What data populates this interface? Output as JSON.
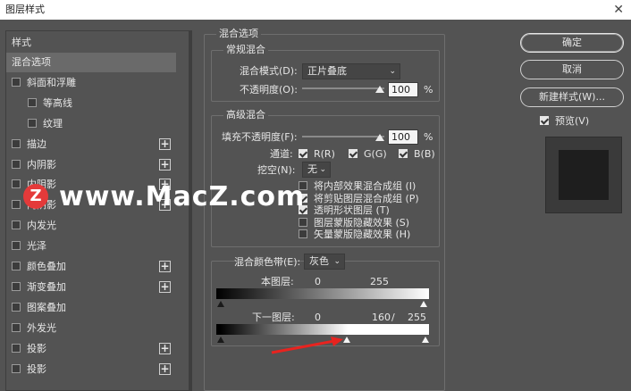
{
  "window": {
    "title": "图层样式",
    "close": "✕"
  },
  "styles": {
    "header": "样式",
    "items": [
      {
        "label": "混合选项",
        "checkbox": false,
        "plus": false,
        "selected": true
      },
      {
        "label": "斜面和浮雕",
        "checkbox": true,
        "plus": false
      },
      {
        "label": "等高线",
        "checkbox": true,
        "plus": false,
        "indent": true
      },
      {
        "label": "纹理",
        "checkbox": true,
        "plus": false,
        "indent": true
      },
      {
        "label": "描边",
        "checkbox": true,
        "plus": true
      },
      {
        "label": "内阴影",
        "checkbox": true,
        "plus": true
      },
      {
        "label": "内阴影",
        "checkbox": true,
        "plus": true
      },
      {
        "label": "内阴影",
        "checkbox": true,
        "plus": true
      },
      {
        "label": "内发光",
        "checkbox": true,
        "plus": false
      },
      {
        "label": "光泽",
        "checkbox": true,
        "plus": false
      },
      {
        "label": "颜色叠加",
        "checkbox": true,
        "plus": true
      },
      {
        "label": "渐变叠加",
        "checkbox": true,
        "plus": true
      },
      {
        "label": "图案叠加",
        "checkbox": true,
        "plus": false
      },
      {
        "label": "外发光",
        "checkbox": true,
        "plus": false
      },
      {
        "label": "投影",
        "checkbox": true,
        "plus": true
      },
      {
        "label": "投影",
        "checkbox": true,
        "plus": true
      }
    ]
  },
  "blend_options": {
    "title": "混合选项",
    "general": {
      "title": "常规混合",
      "mode_label": "混合模式(D):",
      "mode_value": "正片叠底",
      "opacity_label": "不透明度(O):",
      "opacity_value": "100",
      "unit": "%"
    },
    "advanced": {
      "title": "高级混合",
      "fill_label": "填充不透明度(F):",
      "fill_value": "100",
      "unit": "%",
      "channels_label": "通道:",
      "channels": [
        "R(R)",
        "G(G)",
        "B(B)"
      ],
      "knockout_label": "挖空(N):",
      "knockout_value": "无",
      "options": [
        {
          "label": "将内部效果混合成组 (I)",
          "checked": false
        },
        {
          "label": "将剪贴图层混合成组 (P)",
          "checked": true
        },
        {
          "label": "透明形状图层 (T)",
          "checked": true
        },
        {
          "label": "图层蒙版隐藏效果 (S)",
          "checked": false
        },
        {
          "label": "矢量蒙版隐藏效果 (H)",
          "checked": false
        }
      ]
    },
    "blend_if": {
      "label": "混合颜色带(E):",
      "value": "灰色",
      "this_layer_label": "本图层:",
      "this_layer_min": "0",
      "this_layer_max": "255",
      "underlying_label": "下一图层:",
      "underlying_min": "0",
      "underlying_split": "160",
      "underlying_sep": "/",
      "underlying_max": "255"
    }
  },
  "buttons": {
    "ok": "确定",
    "cancel": "取消",
    "new_style": "新建样式(W)...",
    "preview_label": "预览(V)"
  },
  "watermark": {
    "logo": "Z",
    "text": "www.MacZ.com"
  },
  "colors": {
    "accent_arrow": "#e8231f",
    "panel_bg": "#535353"
  }
}
